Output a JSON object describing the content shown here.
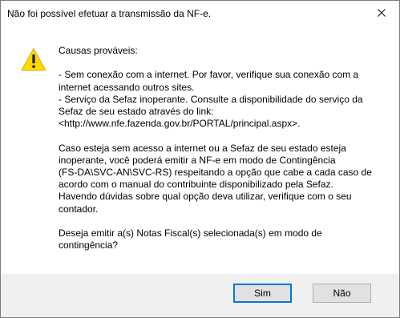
{
  "window": {
    "title": "Não foi possível efetuar a transmissão da NF-e."
  },
  "icon": {
    "type": "warning-icon",
    "color": "#ffd800"
  },
  "message": {
    "paragraphs": [
      "Causas prováveis:",
      "- Sem conexão com a internet. Por favor, verifique sua conexão com a\ninternet acessando outros sites.\n- Serviço da Sefaz inoperante. Consulte a disponibilidade do serviço da\nSefaz de seu estado através do link:\n<http://www.nfe.fazenda.gov.br/PORTAL/principal.aspx>.",
      "Caso esteja sem acesso a internet ou a Sefaz de seu estado esteja\ninoperante, você poderá emitir a NF-e em modo de Contingência\n(FS-DA\\SVC-AN\\SVC-RS) respeitando a opção que cabe a cada caso de\nacordo com o manual do contribuinte disponibilizado pela Sefaz.\nHavendo dúvidas sobre qual opção deva utilizar, verifique com o seu\ncontador.",
      "Deseja emitir a(s) Notas Fiscal(s) selecionada(s) em modo de\ncontingência?"
    ]
  },
  "buttons": {
    "yes_label": "Sim",
    "no_label": "Não"
  },
  "colors": {
    "accent": "#0078d7",
    "footer_bg": "#f0f0f0",
    "button_bg": "#e1e1e1"
  }
}
